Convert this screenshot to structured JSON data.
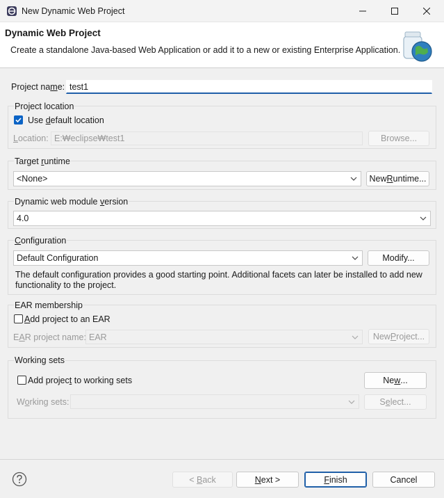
{
  "window": {
    "title": "New Dynamic Web Project"
  },
  "banner": {
    "title": "Dynamic Web Project",
    "description": "Create a standalone Java-based Web Application or add it to a new or existing Enterprise Application."
  },
  "project_name": {
    "label_pre": "Project na",
    "label_u": "m",
    "label_post": "e:",
    "value": "test1"
  },
  "project_location": {
    "group_label": "Project location",
    "use_default_pre": "Use ",
    "use_default_u": "d",
    "use_default_post": "efault location",
    "use_default_checked": true,
    "location_label_u": "L",
    "location_label_post": "ocation:",
    "location_value": "E:₩eclipse₩test1",
    "browse_label": "Browse..."
  },
  "target_runtime": {
    "label_pre": "Target ",
    "label_u": "r",
    "label_post": "untime",
    "value": "<None>",
    "new_runtime_pre": "New ",
    "new_runtime_u": "R",
    "new_runtime_post": "untime..."
  },
  "module_version": {
    "label_pre": "Dynamic web module ",
    "label_u": "v",
    "label_post": "ersion",
    "value": "4.0"
  },
  "configuration": {
    "label_u": "C",
    "label_post": "onfiguration",
    "value": "Default Configuration",
    "modify_label": "Modify...",
    "description": "The default configuration provides a good starting point. Additional facets can later be installed to add new functionality to the project."
  },
  "ear": {
    "group_label": "EAR membership",
    "add_label_u": "A",
    "add_label_post": "dd project to an EAR",
    "add_checked": false,
    "project_name_label_pre": "E",
    "project_name_label_u": "A",
    "project_name_label_post": "R project name:",
    "project_name_value": "EAR",
    "new_project_pre": "New ",
    "new_project_u": "P",
    "new_project_post": "roject..."
  },
  "working_sets": {
    "group_label": "Working sets",
    "add_label_pre": "Add projec",
    "add_label_u": "t",
    "add_label_post": " to working sets",
    "add_checked": false,
    "new_pre": "Ne",
    "new_u": "w",
    "new_post": "...",
    "sets_label_pre": "W",
    "sets_label_u": "o",
    "sets_label_post": "rking sets:",
    "sets_value": "",
    "select_pre": "S",
    "select_u": "e",
    "select_post": "lect..."
  },
  "footer": {
    "back_label": "< ",
    "back_u": "B",
    "back_post": "ack",
    "next_u": "N",
    "next_post": "ext >",
    "finish_u": "F",
    "finish_post": "inish",
    "cancel_label": "Cancel"
  },
  "colors": {
    "accent": "#1f5fa8",
    "checkbox": "#0b63c5",
    "background": "#f0f0f0"
  },
  "icons": [
    "eclipse-app-icon",
    "minimize-icon",
    "maximize-icon",
    "close-icon",
    "jar-globe-icon",
    "chevron-down-icon",
    "help-icon"
  ]
}
